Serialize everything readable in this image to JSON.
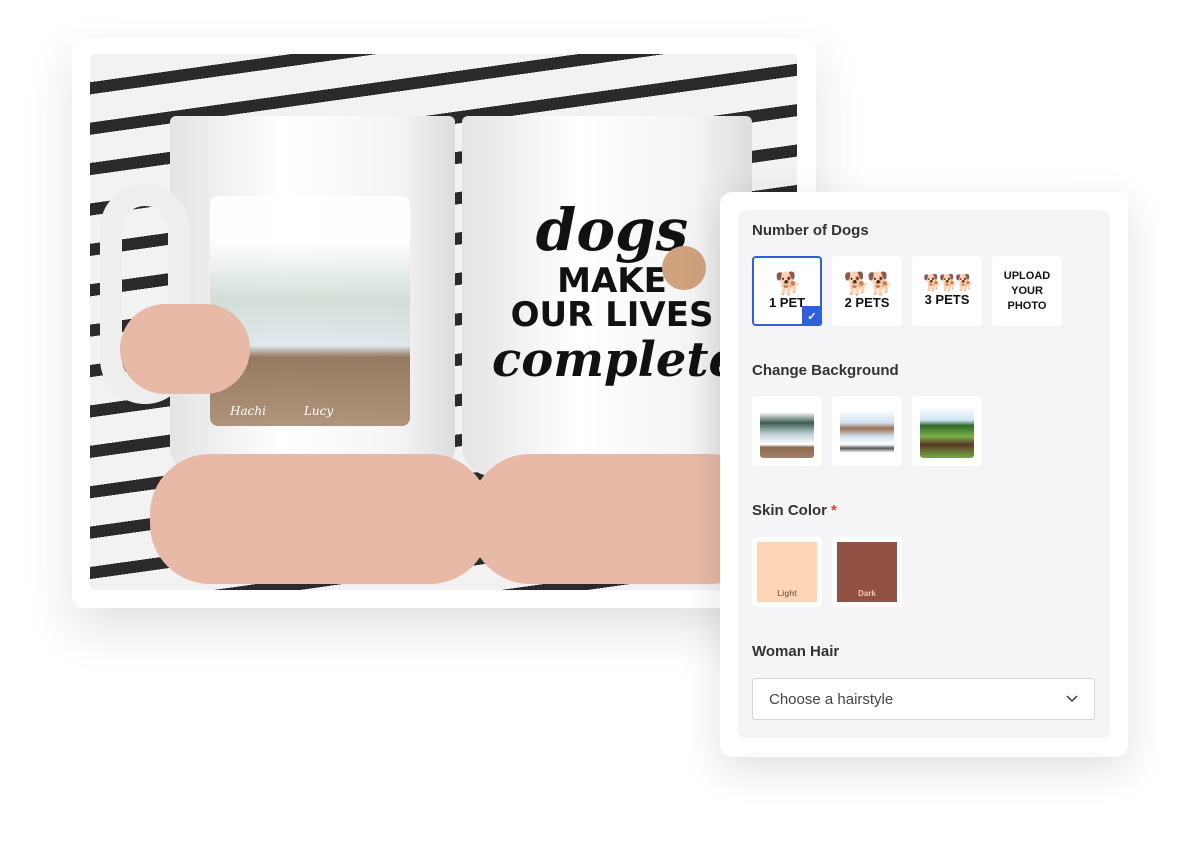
{
  "product_image": {
    "alt_names": [
      "Hachi",
      "Lucy"
    ],
    "mug_text": {
      "line1": "dogs",
      "line2": "MAKE",
      "line3": "OUR LIVES",
      "line4": "complete"
    }
  },
  "options": {
    "number_of_dogs": {
      "label": "Number of Dogs",
      "items": [
        {
          "label": "1 PET",
          "icon": "dog-icon",
          "count": 1,
          "selected": true
        },
        {
          "label": "2 PETS",
          "icon": "dog-icon",
          "count": 2,
          "selected": false
        },
        {
          "label": "3 PETS",
          "icon": "dog-icon",
          "count": 3,
          "selected": false
        },
        {
          "label_lines": [
            "UPLOAD",
            "YOUR",
            "PHOTO"
          ],
          "selected": false
        }
      ]
    },
    "background": {
      "label": "Change Background",
      "items": [
        {
          "name": "mountains-lake"
        },
        {
          "name": "lake-hills"
        },
        {
          "name": "green-field"
        }
      ]
    },
    "skin_color": {
      "label": "Skin Color",
      "required_mark": "*",
      "items": [
        {
          "label": "Light",
          "color": "#fcd6b7"
        },
        {
          "label": "Dark",
          "color": "#925243"
        }
      ]
    },
    "woman_hair": {
      "label": "Woman Hair",
      "placeholder": "Choose a hairstyle"
    }
  },
  "colors": {
    "accent": "#2f5fdc"
  }
}
